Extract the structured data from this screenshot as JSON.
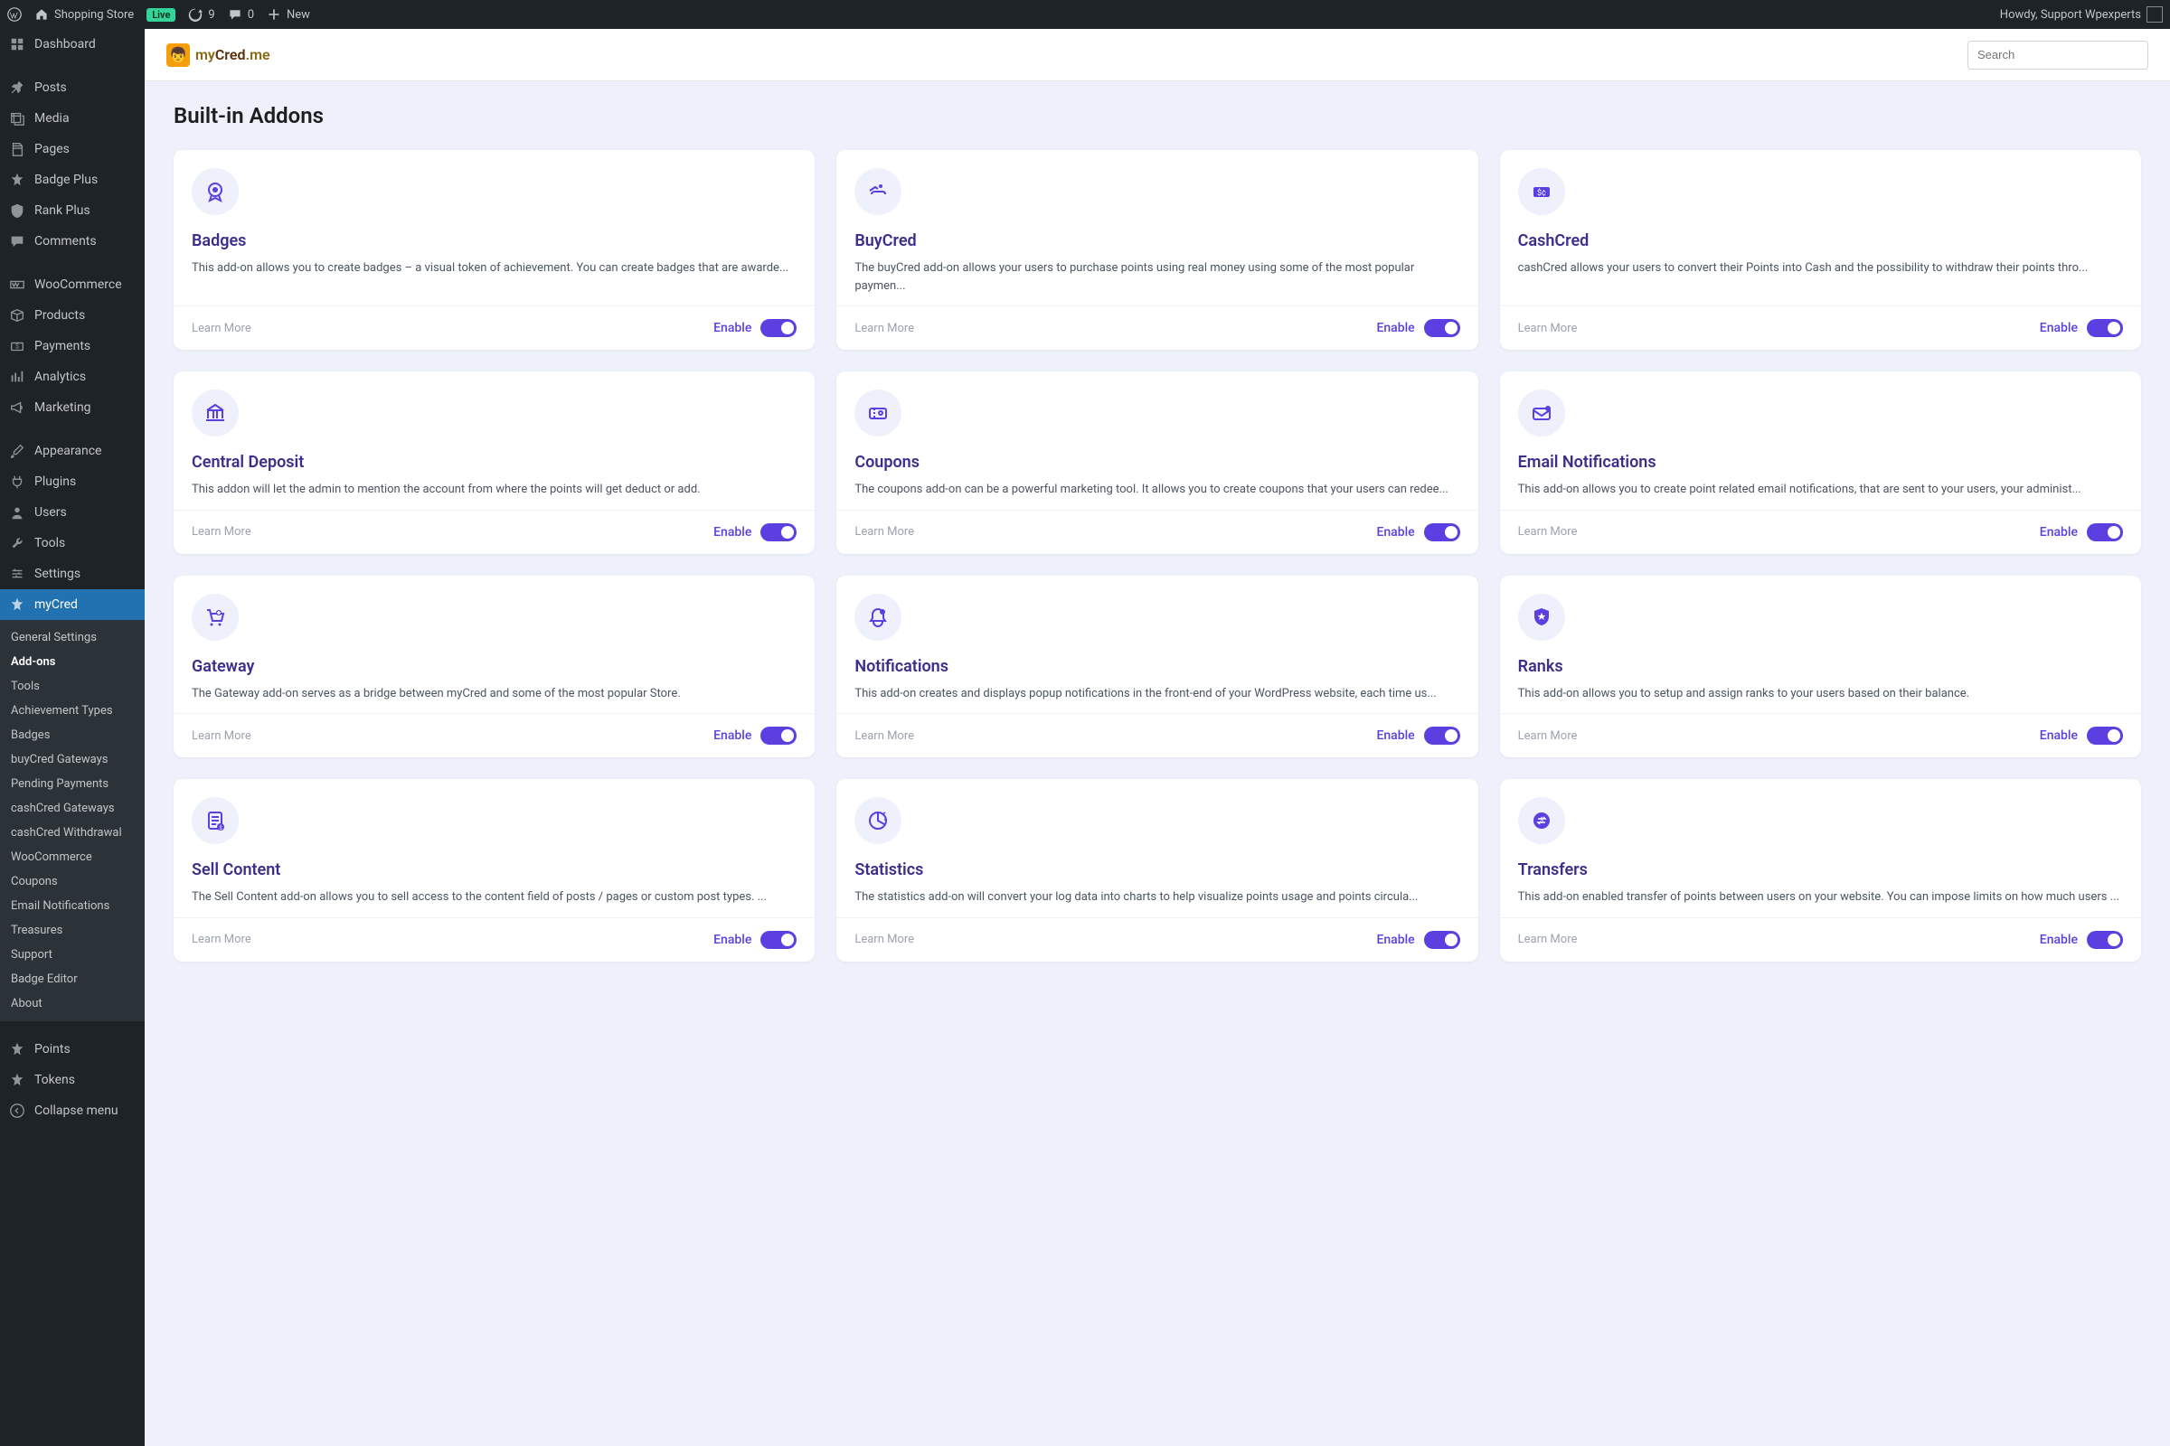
{
  "adminbar": {
    "site_name": "Shopping Store",
    "live": "Live",
    "updates": "9",
    "comments": "0",
    "new": "New",
    "howdy": "Howdy, Support Wpexperts"
  },
  "sidebar": {
    "items": [
      {
        "label": "Dashboard",
        "icon": "dashboard"
      },
      {
        "label": "Posts",
        "icon": "pin"
      },
      {
        "label": "Media",
        "icon": "media"
      },
      {
        "label": "Pages",
        "icon": "pages"
      },
      {
        "label": "Badge Plus",
        "icon": "star"
      },
      {
        "label": "Rank Plus",
        "icon": "shield"
      },
      {
        "label": "Comments",
        "icon": "comment"
      },
      {
        "label": "WooCommerce",
        "icon": "woo"
      },
      {
        "label": "Products",
        "icon": "box"
      },
      {
        "label": "Payments",
        "icon": "money"
      },
      {
        "label": "Analytics",
        "icon": "chart"
      },
      {
        "label": "Marketing",
        "icon": "megaphone"
      },
      {
        "label": "Appearance",
        "icon": "brush"
      },
      {
        "label": "Plugins",
        "icon": "plug"
      },
      {
        "label": "Users",
        "icon": "user"
      },
      {
        "label": "Tools",
        "icon": "wrench"
      },
      {
        "label": "Settings",
        "icon": "sliders"
      },
      {
        "label": "myCred",
        "icon": "star"
      },
      {
        "label": "Points",
        "icon": "star"
      },
      {
        "label": "Tokens",
        "icon": "star"
      },
      {
        "label": "Collapse menu",
        "icon": "collapse"
      }
    ],
    "submenu": [
      "General Settings",
      "Add-ons",
      "Tools",
      "Achievement Types",
      "Badges",
      "buyCred Gateways",
      "Pending Payments",
      "cashCred Gateways",
      "cashCred Withdrawal",
      "WooCommerce",
      "Coupons",
      "Email Notifications",
      "Treasures",
      "Support",
      "Badge Editor",
      "About"
    ]
  },
  "brand": {
    "part1": "my",
    "part2": "Cred",
    "part3": ".me"
  },
  "search": {
    "placeholder": "Search"
  },
  "page_title": "Built-in Addons",
  "labels": {
    "learn_more": "Learn More",
    "enable": "Enable"
  },
  "addons": [
    {
      "title": "Badges",
      "desc": "This add-on allows you to create badges – a visual token of achievement. You can create badges that are awarde...",
      "icon": "ribbon"
    },
    {
      "title": "BuyCred",
      "desc": "The buyCred add-on allows your users to purchase points using real money using some of the most popular paymen...",
      "icon": "hand"
    },
    {
      "title": "CashCred",
      "desc": "cashCred allows your users to convert their Points into Cash and the possibility to withdraw their points thro...",
      "icon": "cash"
    },
    {
      "title": "Central Deposit",
      "desc": "This addon will let the admin to mention the account from where the points will get deduct or add.",
      "icon": "bank"
    },
    {
      "title": "Coupons",
      "desc": "The coupons add-on can be a powerful marketing tool. It allows you to create coupons that your users can redee...",
      "icon": "ticket"
    },
    {
      "title": "Email Notifications",
      "desc": "This add-on allows you to create point related email notifications, that are sent to your users, your administ...",
      "icon": "mail"
    },
    {
      "title": "Gateway",
      "desc": "The Gateway add-on serves as a bridge between myCred and some of the most popular Store.",
      "icon": "cart"
    },
    {
      "title": "Notifications",
      "desc": "This add-on creates and displays popup notifications in the front-end of your WordPress website, each time us...",
      "icon": "bell"
    },
    {
      "title": "Ranks",
      "desc": "This add-on allows you to setup and assign ranks to your users based on their balance.",
      "icon": "shield-star"
    },
    {
      "title": "Sell Content",
      "desc": "The Sell Content add-on allows you to sell access to the content field of posts / pages or custom post types. ...",
      "icon": "receipt"
    },
    {
      "title": "Statistics",
      "desc": "The statistics add-on will convert your log data into charts to help visualize points usage and points circula...",
      "icon": "pie"
    },
    {
      "title": "Transfers",
      "desc": "This add-on enabled transfer of points between users on your website. You can impose limits on how much users ...",
      "icon": "transfer"
    }
  ]
}
